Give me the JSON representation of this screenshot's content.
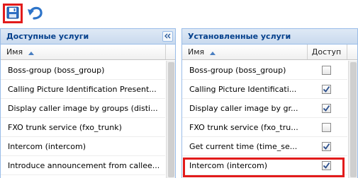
{
  "toolbar": {
    "save_icon": "floppy-disk-icon",
    "undo_icon": "undo-arrow-icon"
  },
  "left_panel": {
    "title": "Доступные услуги",
    "collapse_icon": "double-chevron-left-icon",
    "column_name": "Имя",
    "rows": [
      {
        "name": "Boss-group (boss_group)"
      },
      {
        "name": "Calling Picture Identification Present..."
      },
      {
        "name": "Display caller image by groups (disti..."
      },
      {
        "name": "FXO trunk service (fxo_trunk)"
      },
      {
        "name": "Intercom (intercom)"
      },
      {
        "name": "Introduce announcement from callee..."
      }
    ]
  },
  "right_panel": {
    "title": "Установленные услуги",
    "column_name": "Имя",
    "column_access": "Доступ",
    "rows": [
      {
        "name": "Boss-group (boss_group)",
        "checked": false
      },
      {
        "name": "Calling Picture Identificati...",
        "checked": true
      },
      {
        "name": "Display caller image by gr...",
        "checked": true
      },
      {
        "name": "FXO trunk service (fxo_tru...",
        "checked": false
      },
      {
        "name": "Get current time (time_se...",
        "checked": true
      },
      {
        "name": "Intercom (intercom)",
        "checked": true
      }
    ]
  },
  "colors": {
    "accent_border": "#99bce8",
    "header_text": "#04408c",
    "highlight": "#e21b1b"
  }
}
